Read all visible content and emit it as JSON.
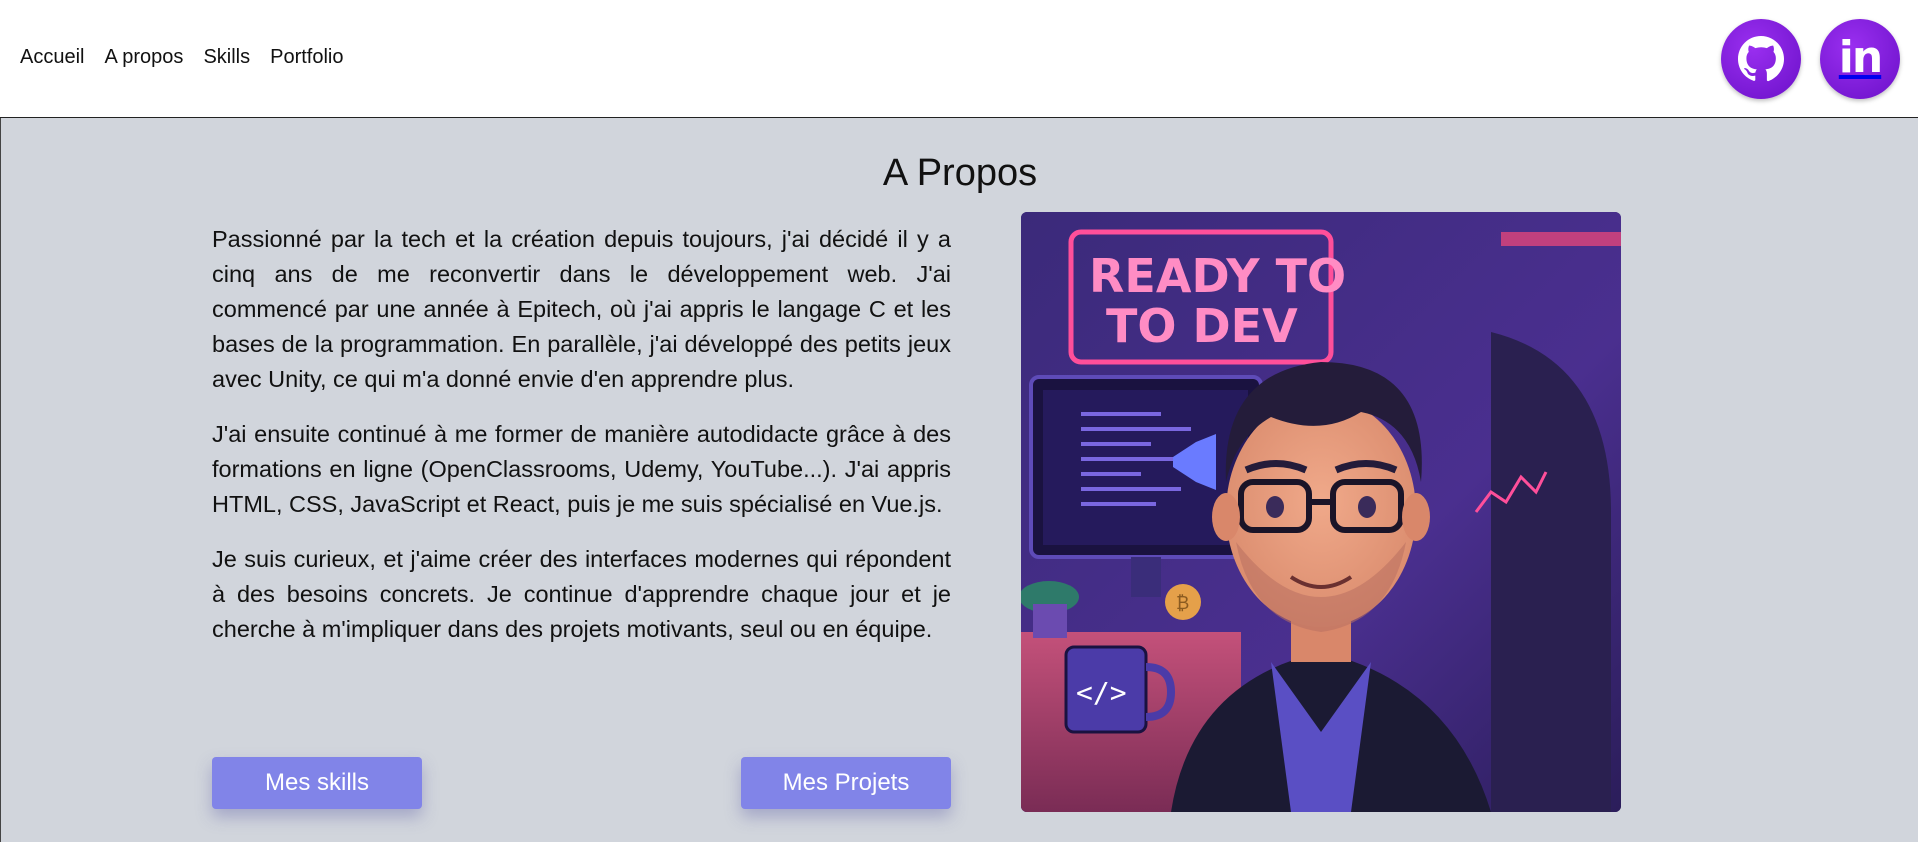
{
  "nav": {
    "items": [
      "Accueil",
      "A propos",
      "Skills",
      "Portfolio"
    ]
  },
  "social": {
    "github_icon": "github-icon",
    "linkedin_label": "in"
  },
  "about": {
    "title": "A Propos",
    "paragraphs": [
      "Passionné par la tech et la création depuis toujours, j'ai décidé il y a cinq ans de me reconvertir dans le développement web. J'ai commencé par une année à Epitech, où j'ai appris le langage C et les bases de la programmation. En parallèle, j'ai développé des petits jeux avec Unity, ce qui m'a donné envie d'en apprendre plus.",
      "J'ai ensuite continué à me former de manière autodidacte grâce à des formations en ligne (OpenClassrooms, Udemy, YouTube...). J'ai appris HTML, CSS, JavaScript et React, puis je me suis spécialisé en Vue.js.",
      "Je suis curieux, et j'aime créer des interfaces modernes qui répondent à des besoins concrets. Je continue d'apprendre chaque jour et je cherche à m'impliquer dans des projets motivants, seul ou en équipe."
    ],
    "buttons": {
      "skills": "Mes skills",
      "projects": "Mes Projets"
    }
  },
  "portrait": {
    "neon_line1": "READY TO",
    "neon_line2": "TO DEV"
  },
  "colors": {
    "accent": "#8184e8",
    "social_bg": "#7b1fd9",
    "main_bg": "#d1d5dc"
  }
}
